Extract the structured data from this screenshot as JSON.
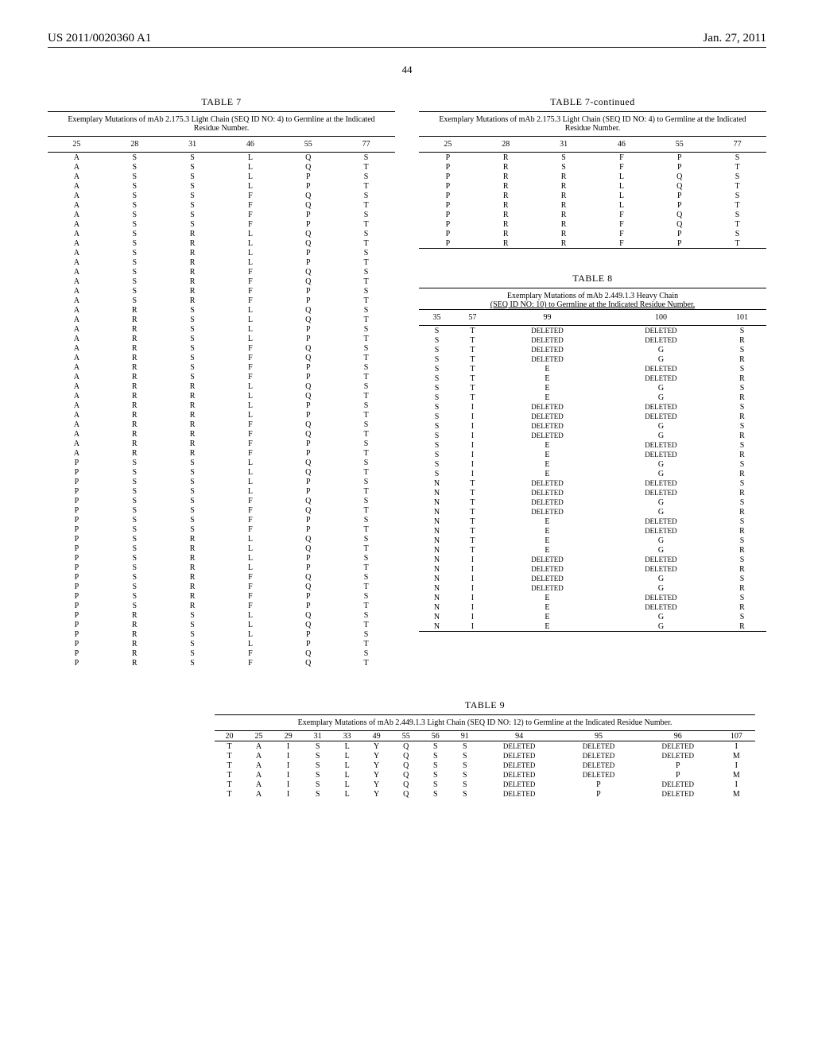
{
  "header": {
    "left": "US 2011/0020360 A1",
    "right": "Jan. 27, 2011"
  },
  "page_number": "44",
  "table7": {
    "title": "TABLE 7",
    "caption": "Exemplary Mutations of mAb 2.175.3 Light Chain (SEQ ID NO: 4) to Germline at the Indicated Residue Number.",
    "columns": [
      "25",
      "28",
      "31",
      "46",
      "55",
      "77"
    ],
    "rows_left": [
      [
        "A",
        "S",
        "S",
        "L",
        "Q",
        "S"
      ],
      [
        "A",
        "S",
        "S",
        "L",
        "Q",
        "T"
      ],
      [
        "A",
        "S",
        "S",
        "L",
        "P",
        "S"
      ],
      [
        "A",
        "S",
        "S",
        "L",
        "P",
        "T"
      ],
      [
        "A",
        "S",
        "S",
        "F",
        "Q",
        "S"
      ],
      [
        "A",
        "S",
        "S",
        "F",
        "Q",
        "T"
      ],
      [
        "A",
        "S",
        "S",
        "F",
        "P",
        "S"
      ],
      [
        "A",
        "S",
        "S",
        "F",
        "P",
        "T"
      ],
      [
        "A",
        "S",
        "R",
        "L",
        "Q",
        "S"
      ],
      [
        "A",
        "S",
        "R",
        "L",
        "Q",
        "T"
      ],
      [
        "A",
        "S",
        "R",
        "L",
        "P",
        "S"
      ],
      [
        "A",
        "S",
        "R",
        "L",
        "P",
        "T"
      ],
      [
        "A",
        "S",
        "R",
        "F",
        "Q",
        "S"
      ],
      [
        "A",
        "S",
        "R",
        "F",
        "Q",
        "T"
      ],
      [
        "A",
        "S",
        "R",
        "F",
        "P",
        "S"
      ],
      [
        "A",
        "S",
        "R",
        "F",
        "P",
        "T"
      ],
      [
        "A",
        "R",
        "S",
        "L",
        "Q",
        "S"
      ],
      [
        "A",
        "R",
        "S",
        "L",
        "Q",
        "T"
      ],
      [
        "A",
        "R",
        "S",
        "L",
        "P",
        "S"
      ],
      [
        "A",
        "R",
        "S",
        "L",
        "P",
        "T"
      ],
      [
        "A",
        "R",
        "S",
        "F",
        "Q",
        "S"
      ],
      [
        "A",
        "R",
        "S",
        "F",
        "Q",
        "T"
      ],
      [
        "A",
        "R",
        "S",
        "F",
        "P",
        "S"
      ],
      [
        "A",
        "R",
        "S",
        "F",
        "P",
        "T"
      ],
      [
        "A",
        "R",
        "R",
        "L",
        "Q",
        "S"
      ],
      [
        "A",
        "R",
        "R",
        "L",
        "Q",
        "T"
      ],
      [
        "A",
        "R",
        "R",
        "L",
        "P",
        "S"
      ],
      [
        "A",
        "R",
        "R",
        "L",
        "P",
        "T"
      ],
      [
        "A",
        "R",
        "R",
        "F",
        "Q",
        "S"
      ],
      [
        "A",
        "R",
        "R",
        "F",
        "Q",
        "T"
      ],
      [
        "A",
        "R",
        "R",
        "F",
        "P",
        "S"
      ],
      [
        "A",
        "R",
        "R",
        "F",
        "P",
        "T"
      ],
      [
        "P",
        "S",
        "S",
        "L",
        "Q",
        "S"
      ],
      [
        "P",
        "S",
        "S",
        "L",
        "Q",
        "T"
      ],
      [
        "P",
        "S",
        "S",
        "L",
        "P",
        "S"
      ],
      [
        "P",
        "S",
        "S",
        "L",
        "P",
        "T"
      ],
      [
        "P",
        "S",
        "S",
        "F",
        "Q",
        "S"
      ],
      [
        "P",
        "S",
        "S",
        "F",
        "Q",
        "T"
      ],
      [
        "P",
        "S",
        "S",
        "F",
        "P",
        "S"
      ],
      [
        "P",
        "S",
        "S",
        "F",
        "P",
        "T"
      ],
      [
        "P",
        "S",
        "R",
        "L",
        "Q",
        "S"
      ],
      [
        "P",
        "S",
        "R",
        "L",
        "Q",
        "T"
      ],
      [
        "P",
        "S",
        "R",
        "L",
        "P",
        "S"
      ],
      [
        "P",
        "S",
        "R",
        "L",
        "P",
        "T"
      ],
      [
        "P",
        "S",
        "R",
        "F",
        "Q",
        "S"
      ],
      [
        "P",
        "S",
        "R",
        "F",
        "Q",
        "T"
      ],
      [
        "P",
        "S",
        "R",
        "F",
        "P",
        "S"
      ],
      [
        "P",
        "S",
        "R",
        "F",
        "P",
        "T"
      ],
      [
        "P",
        "R",
        "S",
        "L",
        "Q",
        "S"
      ],
      [
        "P",
        "R",
        "S",
        "L",
        "Q",
        "T"
      ],
      [
        "P",
        "R",
        "S",
        "L",
        "P",
        "S"
      ],
      [
        "P",
        "R",
        "S",
        "L",
        "P",
        "T"
      ],
      [
        "P",
        "R",
        "S",
        "F",
        "Q",
        "S"
      ],
      [
        "P",
        "R",
        "S",
        "F",
        "Q",
        "T"
      ]
    ],
    "title_cont": "TABLE 7-continued",
    "rows_right": [
      [
        "P",
        "R",
        "S",
        "F",
        "P",
        "S"
      ],
      [
        "P",
        "R",
        "S",
        "F",
        "P",
        "T"
      ],
      [
        "P",
        "R",
        "R",
        "L",
        "Q",
        "S"
      ],
      [
        "P",
        "R",
        "R",
        "L",
        "Q",
        "T"
      ],
      [
        "P",
        "R",
        "R",
        "L",
        "P",
        "S"
      ],
      [
        "P",
        "R",
        "R",
        "L",
        "P",
        "T"
      ],
      [
        "P",
        "R",
        "R",
        "F",
        "Q",
        "S"
      ],
      [
        "P",
        "R",
        "R",
        "F",
        "Q",
        "T"
      ],
      [
        "P",
        "R",
        "R",
        "F",
        "P",
        "S"
      ],
      [
        "P",
        "R",
        "R",
        "F",
        "P",
        "T"
      ]
    ]
  },
  "table8": {
    "title": "TABLE 8",
    "caption_line1": "Exemplary Mutations of mAb 2.449.1.3 Heavy Chain",
    "caption_line2": "(SEQ ID NO: 10) to Germline at the Indicated Residue Number.",
    "columns": [
      "35",
      "57",
      "99",
      "100",
      "101"
    ],
    "rows": [
      [
        "S",
        "T",
        "DELETED",
        "DELETED",
        "S"
      ],
      [
        "S",
        "T",
        "DELETED",
        "DELETED",
        "R"
      ],
      [
        "S",
        "T",
        "DELETED",
        "G",
        "S"
      ],
      [
        "S",
        "T",
        "DELETED",
        "G",
        "R"
      ],
      [
        "S",
        "T",
        "E",
        "DELETED",
        "S"
      ],
      [
        "S",
        "T",
        "E",
        "DELETED",
        "R"
      ],
      [
        "S",
        "T",
        "E",
        "G",
        "S"
      ],
      [
        "S",
        "T",
        "E",
        "G",
        "R"
      ],
      [
        "S",
        "I",
        "DELETED",
        "DELETED",
        "S"
      ],
      [
        "S",
        "I",
        "DELETED",
        "DELETED",
        "R"
      ],
      [
        "S",
        "I",
        "DELETED",
        "G",
        "S"
      ],
      [
        "S",
        "I",
        "DELETED",
        "G",
        "R"
      ],
      [
        "S",
        "I",
        "E",
        "DELETED",
        "S"
      ],
      [
        "S",
        "I",
        "E",
        "DELETED",
        "R"
      ],
      [
        "S",
        "I",
        "E",
        "G",
        "S"
      ],
      [
        "S",
        "I",
        "E",
        "G",
        "R"
      ],
      [
        "N",
        "T",
        "DELETED",
        "DELETED",
        "S"
      ],
      [
        "N",
        "T",
        "DELETED",
        "DELETED",
        "R"
      ],
      [
        "N",
        "T",
        "DELETED",
        "G",
        "S"
      ],
      [
        "N",
        "T",
        "DELETED",
        "G",
        "R"
      ],
      [
        "N",
        "T",
        "E",
        "DELETED",
        "S"
      ],
      [
        "N",
        "T",
        "E",
        "DELETED",
        "R"
      ],
      [
        "N",
        "T",
        "E",
        "G",
        "S"
      ],
      [
        "N",
        "T",
        "E",
        "G",
        "R"
      ],
      [
        "N",
        "I",
        "DELETED",
        "DELETED",
        "S"
      ],
      [
        "N",
        "I",
        "DELETED",
        "DELETED",
        "R"
      ],
      [
        "N",
        "I",
        "DELETED",
        "G",
        "S"
      ],
      [
        "N",
        "I",
        "DELETED",
        "G",
        "R"
      ],
      [
        "N",
        "I",
        "E",
        "DELETED",
        "S"
      ],
      [
        "N",
        "I",
        "E",
        "DELETED",
        "R"
      ],
      [
        "N",
        "I",
        "E",
        "G",
        "S"
      ],
      [
        "N",
        "I",
        "E",
        "G",
        "R"
      ]
    ]
  },
  "table9": {
    "title": "TABLE 9",
    "caption": "Exemplary Mutations of mAb 2.449.1.3 Light Chain (SEQ ID NO: 12) to Germline at the Indicated Residue Number.",
    "columns": [
      "20",
      "25",
      "29",
      "31",
      "33",
      "49",
      "55",
      "56",
      "91",
      "94",
      "95",
      "96",
      "107"
    ],
    "rows": [
      [
        "T",
        "A",
        "I",
        "S",
        "L",
        "Y",
        "Q",
        "S",
        "S",
        "DELETED",
        "DELETED",
        "DELETED",
        "I"
      ],
      [
        "T",
        "A",
        "I",
        "S",
        "L",
        "Y",
        "Q",
        "S",
        "S",
        "DELETED",
        "DELETED",
        "DELETED",
        "M"
      ],
      [
        "T",
        "A",
        "I",
        "S",
        "L",
        "Y",
        "Q",
        "S",
        "S",
        "DELETED",
        "DELETED",
        "P",
        "I"
      ],
      [
        "T",
        "A",
        "I",
        "S",
        "L",
        "Y",
        "Q",
        "S",
        "S",
        "DELETED",
        "DELETED",
        "P",
        "M"
      ],
      [
        "T",
        "A",
        "I",
        "S",
        "L",
        "Y",
        "Q",
        "S",
        "S",
        "DELETED",
        "P",
        "DELETED",
        "I"
      ],
      [
        "T",
        "A",
        "I",
        "S",
        "L",
        "Y",
        "Q",
        "S",
        "S",
        "DELETED",
        "P",
        "DELETED",
        "M"
      ]
    ]
  }
}
